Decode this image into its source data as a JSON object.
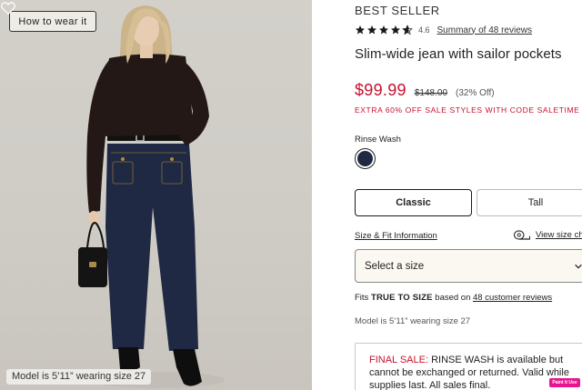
{
  "image": {
    "how_to_wear_label": "How to wear it",
    "model_caption": "Model is 5’11” wearing size 27",
    "jeans_color": "#1f2944",
    "sweater_color": "#231815",
    "background_color": "#d0cdc7"
  },
  "product": {
    "badge": "BEST SELLER",
    "rating": "4.6",
    "rating_value": 4.6,
    "rating_max": 5,
    "reviews_link": "Summary of 48 reviews",
    "title": "Slim-wide jean with sailor pockets",
    "price": "$99.99",
    "original_price": "$148.00",
    "discount": "(32% Off)",
    "promo": "EXTRA 60% OFF SALE STYLES WITH CODE SALETIME",
    "color_label": "Rinse Wash",
    "swatch_color": "#1f2944",
    "sale_color": "#c8102e"
  },
  "fit": {
    "options": [
      "Classic",
      "Tall"
    ],
    "selected": "Classic"
  },
  "size": {
    "size_fit_link": "Size & Fit Information",
    "view_size_chart": "View size ch",
    "select_placeholder": "Select a size"
  },
  "fit_note": {
    "prefix": "Fits ",
    "emphasis": "TRUE TO SIZE",
    "middle": " based on ",
    "link": "48 customer reviews"
  },
  "model_note": "Model is 5’11” wearing size 27",
  "final_sale": {
    "label": "FINAL SALE:",
    "text": " RINSE WASH is available but cannot be exchanged or returned. Valid while supplies last. All sales final."
  },
  "overlay_badge": "Paint It Use"
}
